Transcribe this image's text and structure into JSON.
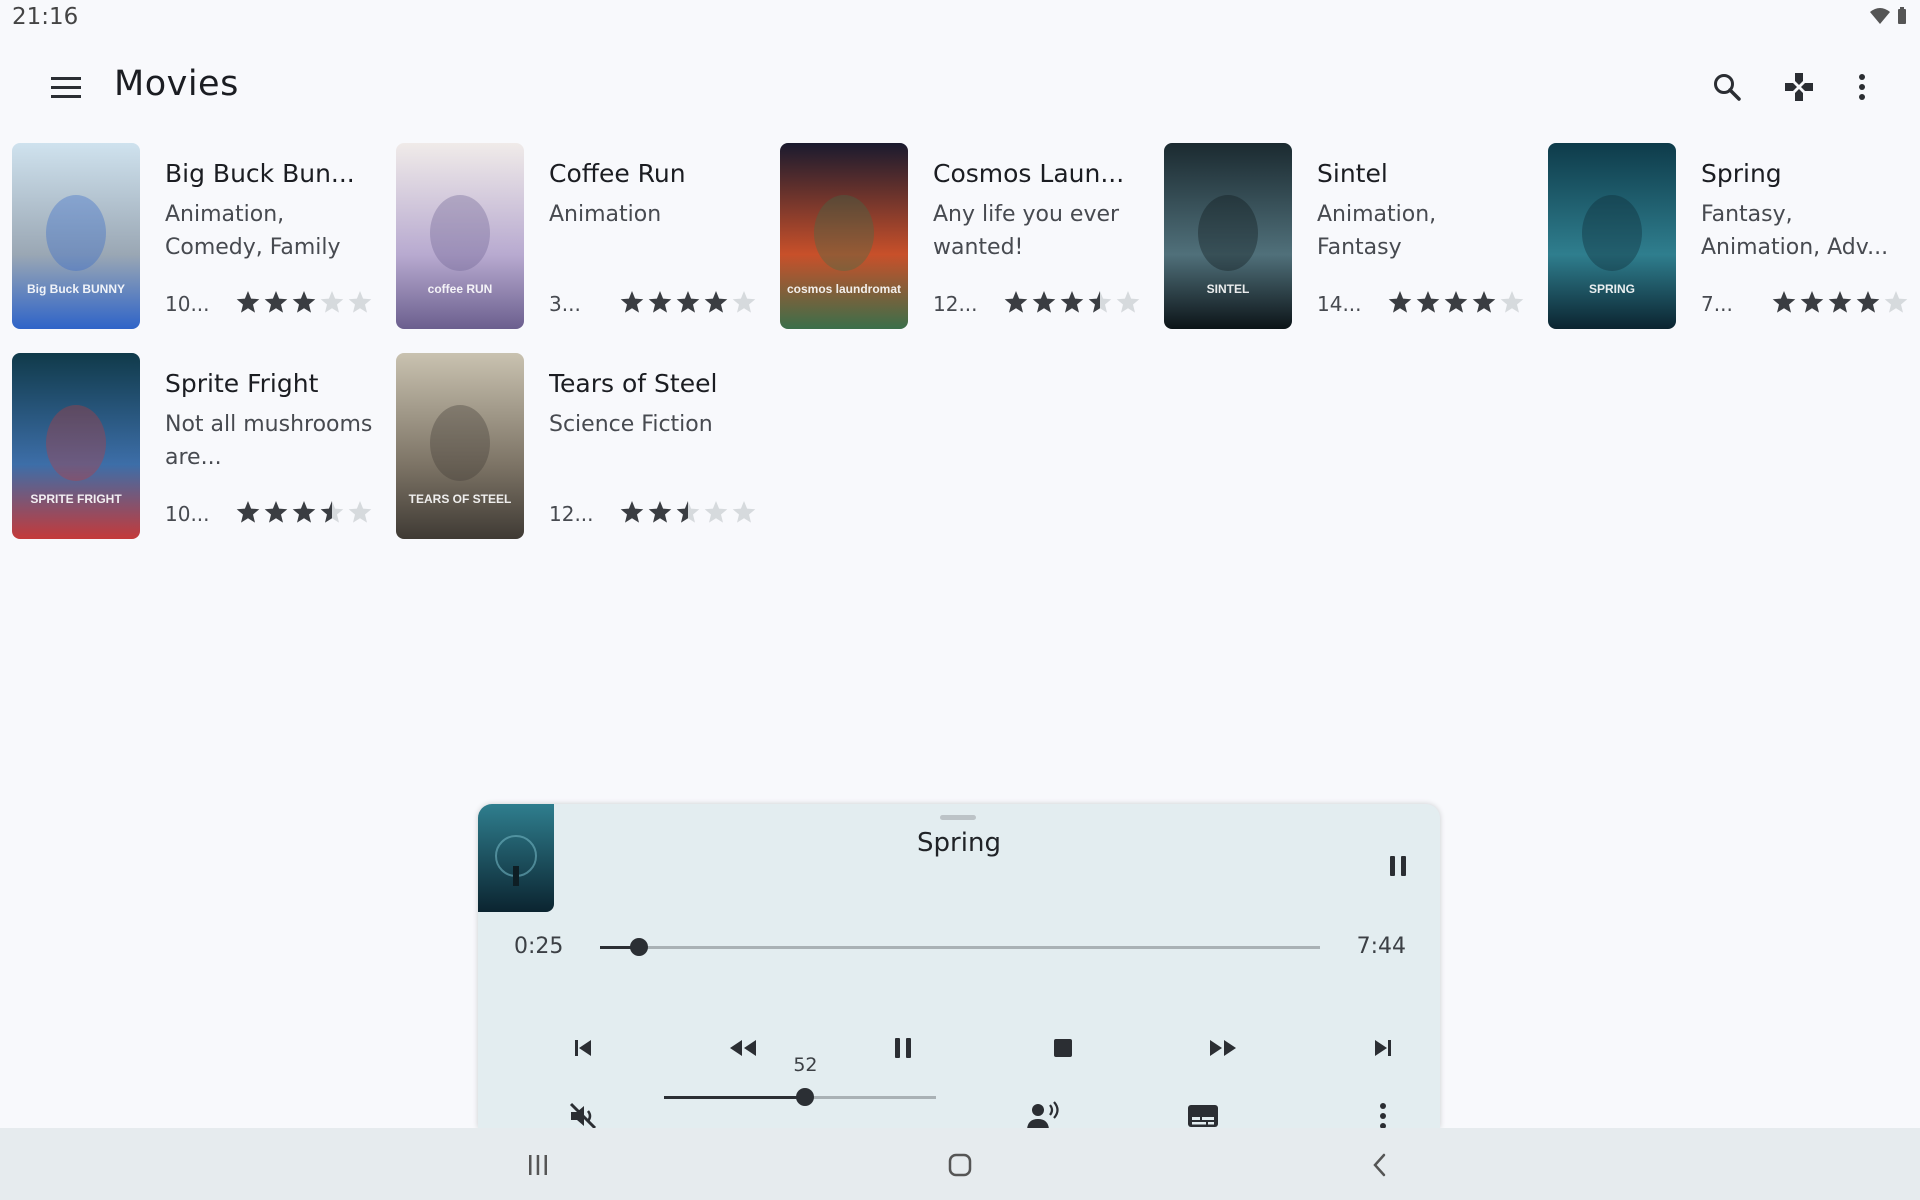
{
  "status": {
    "time": "21:16",
    "icons": [
      "wifi-icon",
      "battery-icon"
    ]
  },
  "appbar": {
    "title": "Movies",
    "actions": [
      "search-icon",
      "gamepad-icon",
      "more-vert-icon"
    ]
  },
  "movies": [
    {
      "title": "Big Buck Bun...",
      "subtitle": "Animation, Comedy, Family",
      "year": "10...",
      "rating": 3.2,
      "poster_colors": [
        "#cfe2ee",
        "#9aa7b4",
        "#2f64c8"
      ],
      "poster_text": "Big Buck BUNNY"
    },
    {
      "title": "Coffee Run",
      "subtitle": "Animation",
      "year": "3...",
      "rating": 4.0,
      "poster_colors": [
        "#f0ebe9",
        "#b8aad0",
        "#6b5f8e"
      ],
      "poster_text": "coffee RUN"
    },
    {
      "title": "Cosmos Laun...",
      "subtitle": "Any life you ever wanted!",
      "year": "12...",
      "rating": 3.3,
      "poster_colors": [
        "#1a1a2e",
        "#c8502a",
        "#3a6f4a"
      ],
      "poster_text": "cosmos laundromat"
    },
    {
      "title": "Sintel",
      "subtitle": "Animation, Fantasy",
      "year": "14...",
      "rating": 4.0,
      "poster_colors": [
        "#1b2a30",
        "#50707a",
        "#0c1418"
      ],
      "poster_text": "SINTEL"
    },
    {
      "title": "Spring",
      "subtitle": "Fantasy, Animation, Adv...",
      "year": "7...",
      "rating": 4.0,
      "poster_colors": [
        "#0e3b4a",
        "#2f7e8e",
        "#0b2430"
      ],
      "poster_text": "SPRING"
    },
    {
      "title": "Sprite Fright",
      "subtitle": "Not all mushrooms are...",
      "year": "10...",
      "rating": 3.5,
      "poster_colors": [
        "#103a4a",
        "#3d6ea8",
        "#c43a3a"
      ],
      "poster_text": "SPRITE FRIGHT"
    },
    {
      "title": "Tears of Steel",
      "subtitle": "Science Fiction",
      "year": "12...",
      "rating": 2.5,
      "poster_colors": [
        "#c9c2b0",
        "#7d7466",
        "#3f3a34"
      ],
      "poster_text": "TEARS OF STEEL"
    }
  ],
  "player": {
    "title": "Spring",
    "current": "0:25",
    "duration": "7:44",
    "progress": 0.054,
    "volume": 52,
    "volume_fraction": 0.52,
    "controls": [
      "skip-previous-icon",
      "rewind-icon",
      "pause-icon",
      "stop-icon",
      "fast-forward-icon",
      "skip-next-icon"
    ],
    "extras": [
      "mute-icon",
      "voice-icon",
      "subtitles-icon",
      "more-vert-icon"
    ]
  },
  "navbar": [
    "recents-icon",
    "home-icon",
    "back-icon"
  ]
}
